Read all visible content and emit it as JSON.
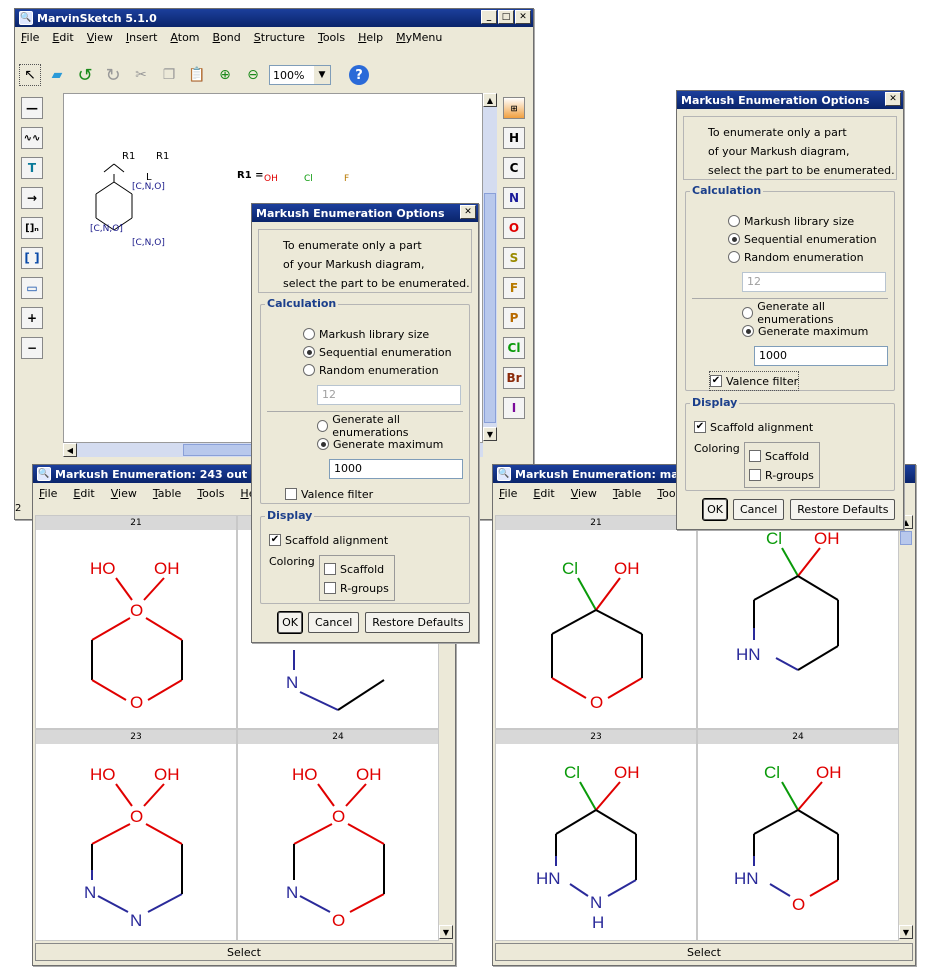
{
  "main_window": {
    "title": "MarvinSketch 5.1.0",
    "menu": [
      "File",
      "Edit",
      "View",
      "Insert",
      "Atom",
      "Bond",
      "Structure",
      "Tools",
      "Help",
      "MyMenu"
    ],
    "zoom": "100%",
    "r1_label": "R1 =",
    "rgroups": [
      "OH",
      "Cl",
      "F"
    ],
    "element_buttons": [
      "H",
      "C",
      "N",
      "O",
      "S",
      "F",
      "P",
      "Cl",
      "Br",
      "I"
    ],
    "scaffold_labels": {
      "r1a": "R1",
      "r1b": "R1",
      "l": "L",
      "cno1": "[C,N,O]",
      "cno2": "[C,N,O]",
      "cno3": "[C,N,O]"
    }
  },
  "dialog_center": {
    "title": "Markush Enumeration Options",
    "intro": [
      "To enumerate only a part",
      "of your Markush diagram,",
      "select the part to be enumerated."
    ],
    "calc_title": "Calculation",
    "radio_library": "Markush library size",
    "radio_sequential": "Sequential enumeration",
    "radio_random": "Random enumeration",
    "random_value": "12",
    "radio_all": "Generate all enumerations",
    "radio_max": "Generate maximum",
    "max_value": "1000",
    "valence": "Valence filter",
    "display_title": "Display",
    "scaffold_alignment": "Scaffold alignment",
    "coloring": "Coloring",
    "scaffold": "Scaffold",
    "rgroups": "R-groups",
    "ok": "OK",
    "cancel": "Cancel",
    "restore": "Restore Defaults"
  },
  "dialog_right": {
    "title": "Markush Enumeration Options",
    "intro": [
      "To enumerate only a part",
      "of your Markush diagram,",
      "select the part to be enumerated."
    ],
    "calc_title": "Calculation",
    "radio_library": "Markush library size",
    "radio_sequential": "Sequential enumeration",
    "radio_random": "Random enumeration",
    "random_value": "12",
    "radio_all": "Generate all enumerations",
    "radio_max": "Generate maximum",
    "max_value": "1000",
    "valence": "Valence filter",
    "display_title": "Display",
    "scaffold_alignment": "Scaffold alignment",
    "coloring": "Coloring",
    "scaffold": "Scaffold",
    "rgroups": "R-groups",
    "ok": "OK",
    "cancel": "Cancel",
    "restore": "Restore Defaults"
  },
  "enum_left": {
    "title": "Markush Enumeration: 243 out of 2",
    "menu": [
      "File",
      "Edit",
      "View",
      "Table",
      "Tools",
      "Hel"
    ],
    "cells": [
      "21",
      "22",
      "23",
      "24"
    ],
    "select": "Select"
  },
  "enum_right": {
    "title": "Markush Enumeration: max.",
    "menu": [
      "File",
      "Edit",
      "View",
      "Table",
      "Tool"
    ],
    "cells": [
      "21",
      "22",
      "23",
      "24"
    ],
    "select": "Select"
  },
  "status_left": "2",
  "atoms": {
    "HO": "HO",
    "OH": "OH",
    "O": "O",
    "N": "N",
    "Cl": "Cl",
    "HN": "HN",
    "H": "H"
  },
  "colors": {
    "title_bar": "#0a246a",
    "oxygen": "#e00000",
    "nitrogen": "#2a2a9a",
    "chlorine": "#0a9a0a",
    "bond": "#000000",
    "group_title": "#1b3f8b"
  }
}
